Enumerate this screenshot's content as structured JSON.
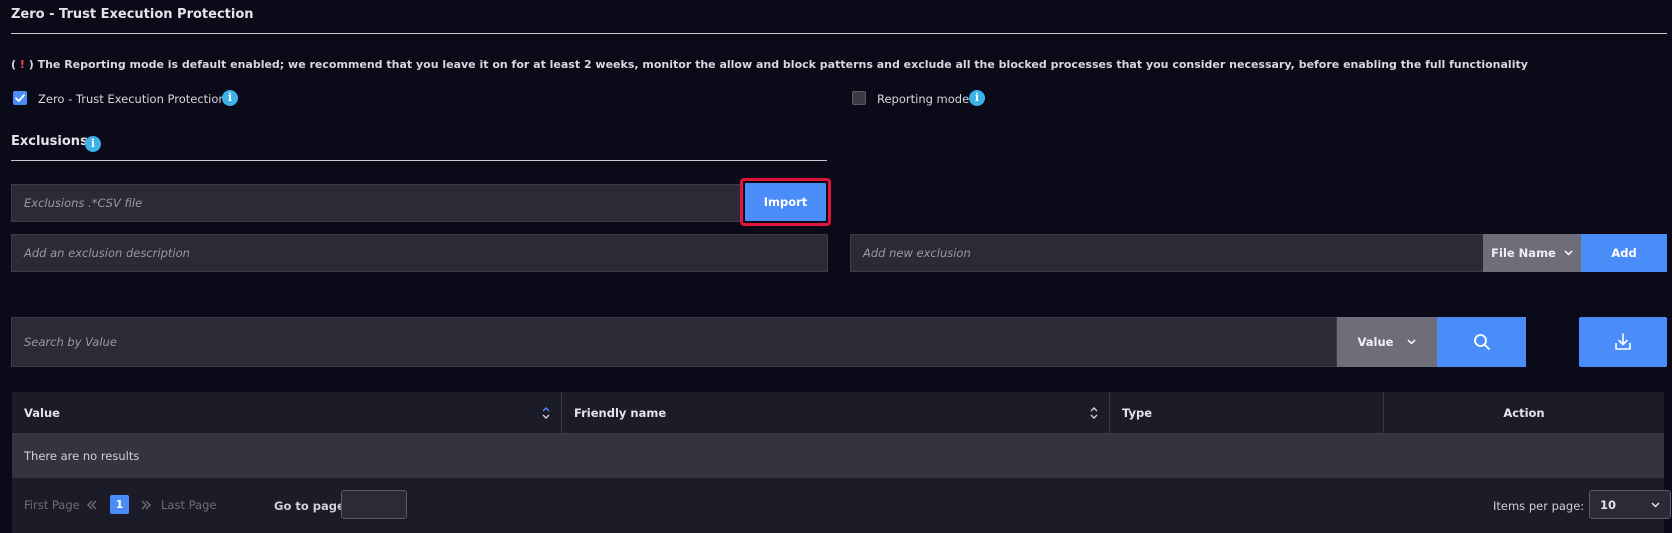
{
  "section": {
    "title": "Zero - Trust Execution Protection"
  },
  "warning": {
    "prefix_open": "( ",
    "bang": "!",
    "prefix_close": " ) ",
    "text": "The Reporting mode is default enabled; we recommend that you leave it on for at least 2 weeks, monitor the allow and block patterns and exclude all the blocked processes that you consider necessary, before enabling the full functionality"
  },
  "checkboxes": [
    {
      "label": "Zero - Trust Execution Protection",
      "checked": true
    },
    {
      "label": "Reporting mode",
      "checked": false
    }
  ],
  "exclusions": {
    "title": "Exclusions",
    "file_placeholder": "Exclusions .*CSV file",
    "import_label": "Import",
    "description_placeholder": "Add an exclusion description",
    "new_placeholder": "Add new exclusion",
    "type_selected": "File Name",
    "add_label": "Add"
  },
  "search": {
    "placeholder": "Search by Value",
    "field_selected": "Value"
  },
  "table": {
    "columns": [
      "Value",
      "Friendly name",
      "Type",
      "Action"
    ],
    "empty_text": "There are no results"
  },
  "pagination": {
    "first_label": "First Page",
    "current_page": "1",
    "last_label": "Last Page",
    "goto_label": "Go to page:",
    "items_label": "Items per page:",
    "items_value": "10"
  },
  "colors": {
    "accent": "#4b8df8",
    "background": "#0a0a18",
    "highlight": "#e0153e",
    "info": "#3bb2ea"
  }
}
